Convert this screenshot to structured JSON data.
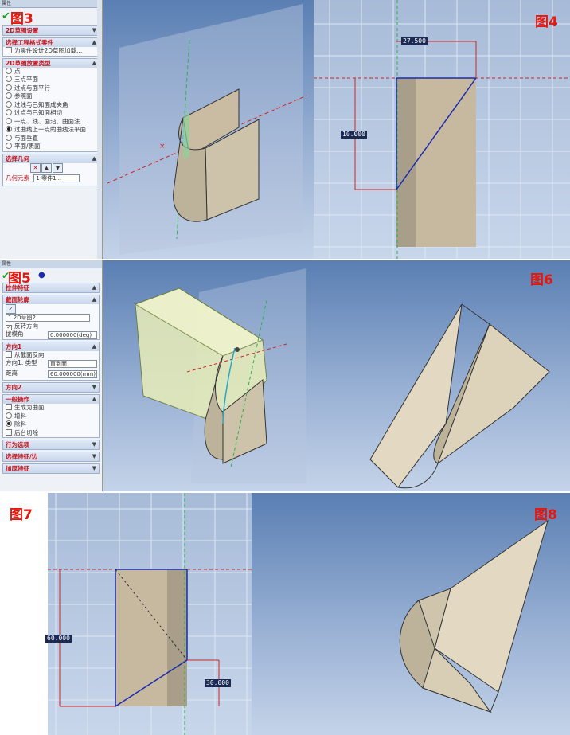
{
  "figures": {
    "fig3": "图3",
    "fig4": "图4",
    "fig5": "图5",
    "fig6": "图6",
    "fig7": "图7",
    "fig8": "图8"
  },
  "panel3": {
    "section1": "2D草图设置",
    "section2": "选择工程格式零件",
    "checkbox1": "为零件设计2D草图加载...",
    "section3": "2D草图放置类型",
    "options": [
      "点",
      "三点平面",
      "过点与面平行",
      "参照面",
      "过线与已知面成夹角",
      "过点与已知面相切",
      "一点、线、面沿、曲面法...",
      "过曲线上一点的曲线法平面",
      "与面垂直",
      "平面/表面"
    ],
    "selected_option": 7,
    "section4": "选择几何",
    "geo_label": "几何元素",
    "geo_item": "1  零件1..."
  },
  "panel5": {
    "header": "拉伸特征",
    "section1": "截面轮廓",
    "profile_item": "1  2D草图2",
    "check_ft": "反转方向",
    "draft_label": "拔模角",
    "draft_value": "0.000000(deg)",
    "dir1": "方向1",
    "dir1_check": "从截面反向",
    "dir1_type_label": "方向1: 类型",
    "dir1_type_value": "直到面",
    "dir1_dist_label": "距离",
    "dir1_dist_value": "60.000000(mm)",
    "dir2": "方向2",
    "general": "一般操作",
    "gen_opt1": "生成为曲面",
    "gen_opt2": "增料",
    "gen_opt3": "除料",
    "gen_opt4": "后台切除",
    "sec_a": "行为选项",
    "sec_b": "选择特征/边",
    "sec_c": "加厚特征"
  },
  "fig4": {
    "dim_h": "27.500",
    "dim_v": "10.000"
  },
  "fig7": {
    "dim_left": "60.000",
    "dim_right": "30.000"
  }
}
